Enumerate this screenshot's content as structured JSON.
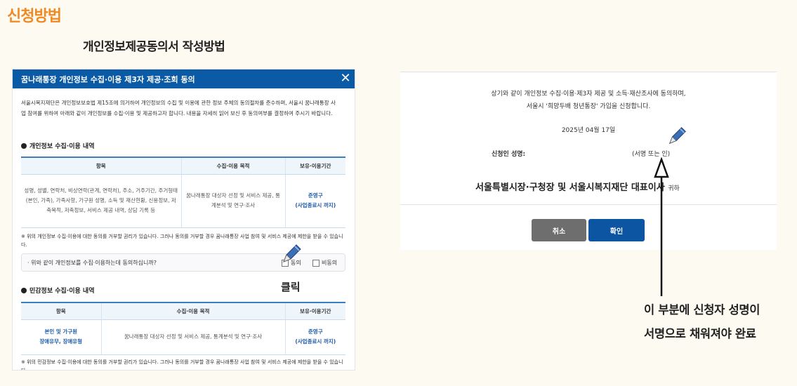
{
  "heading": "신청방법",
  "subheading": "개인정보제공동의서 작성방법",
  "dialog": {
    "title": "꿈나래통장 개인정보 수집·이용 제3자 제공·조회 동의",
    "close": "✕",
    "intro": "서울시복지재단은 개인정보보호법 제15조에 의거하여 개인정보의 수집 및 이용에 관한 정보 주체의 동의절차를 준수하며, 서울시 꿈나래통장 사업 참여를 위하여 아래와 같이 개인정보를 수집·이용 및 제공하고자 합니다. 내용을 자세히 읽어 보신 후 동의여부를 결정하여 주시기 바랍니다.",
    "section1": {
      "title": "개인정보 수집·이용 내역",
      "headers": [
        "항목",
        "수집·이용 목적",
        "보유·이용기간"
      ],
      "items": "성명, 성별, 연락처, 비상연락(관계, 연락처), 주소, 거주기간, 주거형태(본인, 가족), 가족사항, 가구원 성명, 소득 및 재산현황, 신용정보, 저축목적, 저축정보, 서비스 제공 내역, 상담 기록 등",
      "purpose": "꿈나래통장 대상자 선정 및 서비스 제공, 통계분석 및 연구·조사",
      "period1": "준영구",
      "period2": "(사업종료시 까지)",
      "note": "※ 위의 개인정보 수집·이용에 대한 동의를 거부할 권리가 있습니다. 그러나 동의를 거부할 경우 꿈나래통장 사업 참여 및 서비스 제공에 제한을 받을 수 있습니다."
    },
    "agree_question": "· 위와 같이 개인정보를 수집·이용하는데 동의하십니까?",
    "agree": "동의",
    "disagree": "비동의",
    "section2": {
      "title": "민감정보 수집·이용 내역",
      "headers": [
        "항목",
        "수집·이용 목적",
        "보유·이용기간"
      ],
      "items1": "본인 및 가구원",
      "items2": "장애유무, 장애유형",
      "purpose": "꿈나래통장 대상자 선정 및 서비스 제공, 통계분석 및 연구·조사",
      "period1": "준영구",
      "period2": "(사업종료시 까지)",
      "note": "※ 위의 민감정보 수집·이용에 대한 동의를 거부할 권리가 있습니다. 그러나 동의를 거부할 경우 꿈나래통장 사업 참여 및 서비스 제공에 제한을 받을 수 있습니다."
    }
  },
  "click_label": "클릭",
  "panel": {
    "line1": "상기와 같이 개인정보 수집·이용·제3자 제공 및 소득·재산조사에 동의하며,",
    "line2": "서울시 '희망두배 청년통장' 가입을 신청합니다.",
    "date": "2025년 04월 17일",
    "sign_label": "신청인 성명:",
    "sign_placeholder": "(서명 또는 인)",
    "addressee": "서울특별시장·구청장 및 서울시복지재단 대표이사",
    "addressee_suffix": "귀하",
    "cancel": "취소",
    "confirm": "확인"
  },
  "annotation": {
    "line1": "이 부분에 신청자 성명이",
    "line2": "서명으로 채워져야 완료"
  },
  "colors": {
    "accent": "#f08a24",
    "primary": "#0a5aa6",
    "cancel": "#6e6e6e"
  },
  "icons": [
    "pen-icon",
    "close-icon",
    "arrow-up-icon"
  ]
}
